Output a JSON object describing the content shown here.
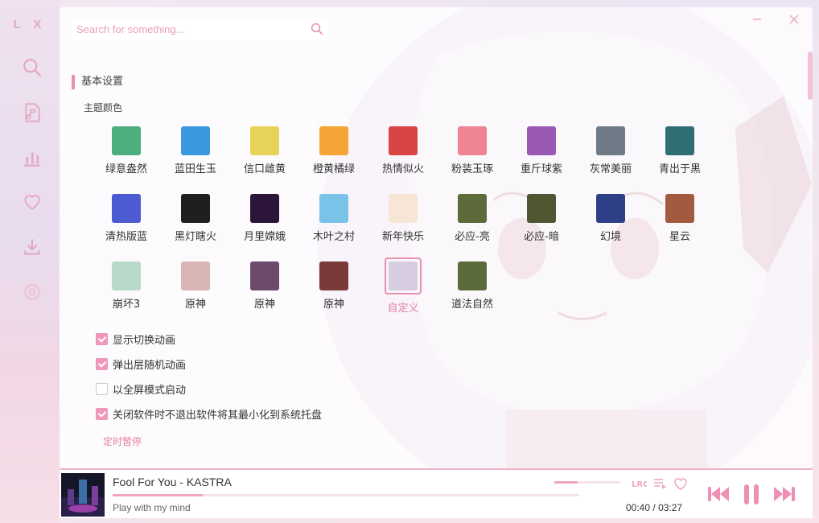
{
  "app": {
    "logo": "L X"
  },
  "sidebar": {
    "items": [
      {
        "name": "search",
        "icon": "search-icon"
      },
      {
        "name": "songlist",
        "icon": "music-file-icon"
      },
      {
        "name": "leaderboard",
        "icon": "bar-chart-icon"
      },
      {
        "name": "my-list",
        "icon": "heart-icon"
      },
      {
        "name": "download",
        "icon": "download-icon"
      },
      {
        "name": "settings",
        "icon": "settings-icon"
      }
    ]
  },
  "search": {
    "placeholder": "Search for something..."
  },
  "settings": {
    "section_title": "基本设置",
    "theme_heading": "主题颜色",
    "themes": [
      {
        "label": "绿意盎然",
        "color": "#4caf7d"
      },
      {
        "label": "蓝田生玉",
        "color": "#3a98de"
      },
      {
        "label": "信口雌黄",
        "color": "#e8d35a"
      },
      {
        "label": "橙黄橘绿",
        "color": "#f5a535"
      },
      {
        "label": "热情似火",
        "color": "#d94444"
      },
      {
        "label": "粉装玉琢",
        "color": "#ef8493"
      },
      {
        "label": "重斤球紫",
        "color": "#9b59b6"
      },
      {
        "label": "灰常美丽",
        "color": "#6e7a86"
      },
      {
        "label": "青出于黑",
        "color": "#2f6f74"
      },
      {
        "label": "清热版蓝",
        "color": "#4d5bd2"
      },
      {
        "label": "黑灯瞎火",
        "color": "#1f1f1f"
      },
      {
        "label": "月里嫦娥",
        "color": "#2b1538"
      },
      {
        "label": "木叶之村",
        "color": "#79c3e8"
      },
      {
        "label": "新年快乐",
        "color": "#f7e6d6"
      },
      {
        "label": "必应-亮",
        "color": "#5d6b3a"
      },
      {
        "label": "必应-暗",
        "color": "#4e5730"
      },
      {
        "label": "幻境",
        "color": "#2d3f87"
      },
      {
        "label": "星云",
        "color": "#a45a3e"
      },
      {
        "label": "崩坏3",
        "color": "#b8d8c8"
      },
      {
        "label": "原神",
        "color": "#d9b5b5"
      },
      {
        "label": "原神",
        "color": "#6b4a6a"
      },
      {
        "label": "原神",
        "color": "#7a3a3a"
      },
      {
        "label": "自定义",
        "color": "#d8cde0"
      },
      {
        "label": "道法自然",
        "color": "#5a6a3a"
      }
    ],
    "selected_theme": "自定义",
    "options": [
      {
        "label": "显示切换动画",
        "checked": true
      },
      {
        "label": "弹出层随机动画",
        "checked": true
      },
      {
        "label": "以全屏模式启动",
        "checked": false
      },
      {
        "label": "关闭软件时不退出软件将其最小化到系统托盘",
        "checked": true
      }
    ],
    "timer_link": "定时暂停"
  },
  "player": {
    "title": "Fool For You - KASTRA",
    "subtitle": "Play with my mind",
    "current_time": "00:40",
    "separator": "/",
    "total_time": "03:27",
    "progress": 0.193,
    "volume": 0.35,
    "accent": "#ee8fb3"
  }
}
